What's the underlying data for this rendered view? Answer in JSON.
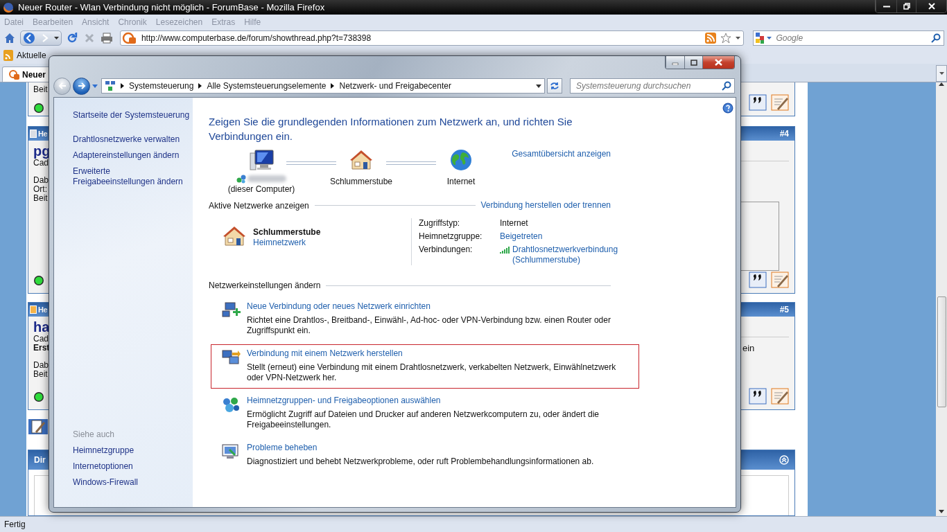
{
  "browser": {
    "title": "Neuer Router - Wlan Verbindung nicht möglich - ForumBase - Mozilla Firefox",
    "menu": [
      "Datei",
      "Bearbeiten",
      "Ansicht",
      "Chronik",
      "Lesezeichen",
      "Extras",
      "Hilfe"
    ],
    "url": "http://www.computerbase.de/forum/showthread.php?t=738398",
    "search_placeholder": "Google",
    "bookmarks": [
      "Aktuelle"
    ],
    "tab": "Neuer",
    "status": "Fertig"
  },
  "forum": {
    "posts": [
      {
        "blocks": [
          [
            {
              "text": "Beit",
              "bold": false
            }
          ]
        ]
      },
      {
        "header": "He",
        "number": "#4",
        "unread": false,
        "name": "pg",
        "kind": "box",
        "blocks": [
          [
            {
              "text": "Cad",
              "bold": false
            }
          ],
          [
            {
              "text": "Dab",
              "bold": false
            },
            {
              "text": "Ort:",
              "bold": false
            },
            {
              "text": "Beit",
              "bold": false
            }
          ]
        ]
      },
      {
        "header": "He",
        "number": "#5",
        "unread": true,
        "name": "ha",
        "kind": "text",
        "aside": "ein",
        "blocks": [
          [
            {
              "text": "Cad",
              "bold": false
            },
            {
              "text": "Erst",
              "bold": true
            }
          ],
          [
            {
              "text": "Dab",
              "bold": false
            },
            {
              "text": "Beit",
              "bold": false
            }
          ]
        ]
      }
    ],
    "section": {
      "title": "Dir"
    }
  },
  "dialog": {
    "breadcrumb": [
      "Systemsteuerung",
      "Alle Systemsteuerungselemente",
      "Netzwerk- und Freigabecenter"
    ],
    "search_placeholder": "Systemsteuerung durchsuchen",
    "sidebar": {
      "links": [
        "Startseite der Systemsteuerung",
        "Drahtlosnetzwerke verwalten",
        "Adaptereinstellungen ändern",
        "Erweiterte Freigabeeinstellungen ändern"
      ],
      "see_also_title": "Siehe auch",
      "see_also": [
        "Heimnetzgruppe",
        "Internetoptionen",
        "Windows-Firewall"
      ]
    },
    "heading": "Zeigen Sie die grundlegenden Informationen zum Netzwerk an, und richten Sie Verbindungen ein.",
    "map": {
      "nodes": [
        {
          "kind": "computer",
          "label": "(dieser Computer)"
        },
        {
          "kind": "house",
          "label": "Schlummerstube"
        },
        {
          "kind": "globe",
          "label": "Internet"
        }
      ],
      "full_map_link": "Gesamtübersicht anzeigen"
    },
    "active": {
      "title": "Aktive Netzwerke anzeigen",
      "link": "Verbindung herstellen oder trennen",
      "network": {
        "name": "Schlummerstube",
        "type": "Heimnetzwerk"
      },
      "properties": [
        {
          "label": "Zugriffstyp:",
          "value": "Internet",
          "kind": "text"
        },
        {
          "label": "Heimnetzgruppe:",
          "value": "Beigetreten",
          "kind": "link"
        },
        {
          "label": "Verbindungen:",
          "value": "Drahtlosnetzwerkverbindung (Schlummerstube)",
          "kind": "wifi"
        }
      ]
    },
    "settings": {
      "title": "Netzwerkeinstellungen ändern",
      "tasks": [
        {
          "kind": "new",
          "selected": false,
          "title": "Neue Verbindung oder neues Netzwerk einrichten",
          "description": "Richtet eine Drahtlos-, Breitband-, Einwähl-, Ad-hoc- oder VPN-Verbindung bzw. einen Router oder Zugriffspunkt ein."
        },
        {
          "kind": "connect",
          "selected": true,
          "title": "Verbindung mit einem Netzwerk herstellen",
          "description": "Stellt (erneut) eine Verbindung mit einem Drahtlosnetzwerk, verkabelten Netzwerk, Einwählnetzwerk oder VPN-Netzwerk her."
        },
        {
          "kind": "homegroup",
          "selected": false,
          "title": "Heimnetzgruppen- und Freigabeoptionen auswählen",
          "description": "Ermöglicht Zugriff auf Dateien und Drucker auf anderen Netzwerkcomputern zu, oder ändert die Freigabeeinstellungen."
        },
        {
          "kind": "troubleshoot",
          "selected": false,
          "title": "Probleme beheben",
          "description": "Diagnostiziert und behebt Netzwerkprobleme, oder ruft Problembehandlungsinformationen ab."
        }
      ]
    }
  }
}
